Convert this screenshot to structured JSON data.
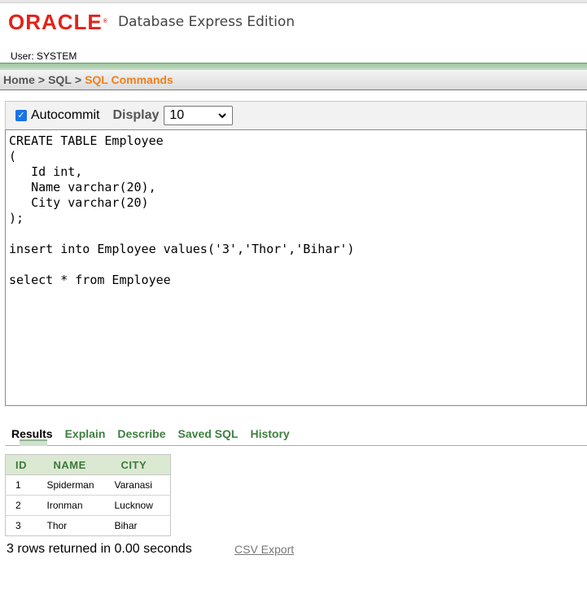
{
  "header": {
    "logo_text": "ORACLE",
    "logo_mark": "®",
    "product_name": "Database Express Edition",
    "user_line": "User: SYSTEM"
  },
  "breadcrumb": {
    "items": [
      "Home",
      "SQL",
      "SQL Commands"
    ],
    "separator": ">"
  },
  "toolbar": {
    "autocommit_checked": true,
    "autocommit_label": "Autocommit",
    "display_label": "Display",
    "display_value": "10"
  },
  "editor": {
    "lines": [
      "CREATE TABLE Employee",
      "(",
      "   Id int,",
      "   Name varchar(20),",
      "   City varchar(20)",
      ");",
      "",
      "insert into Employee values('3','Thor','Bihar')",
      "",
      "select * from Employee"
    ]
  },
  "tabs": [
    {
      "label": "Results",
      "active": true
    },
    {
      "label": "Explain",
      "active": false
    },
    {
      "label": "Describe",
      "active": false
    },
    {
      "label": "Saved SQL",
      "active": false
    },
    {
      "label": "History",
      "active": false
    }
  ],
  "results": {
    "columns": [
      "ID",
      "NAME",
      "CITY"
    ],
    "rows": [
      [
        "1",
        "Spiderman",
        "Varanasi"
      ],
      [
        "2",
        "Ironman",
        "Lucknow"
      ],
      [
        "3",
        "Thor",
        "Bihar"
      ]
    ],
    "status": "3 rows returned in 0.00 seconds",
    "export_label": "CSV Export"
  },
  "colors": {
    "brand_red": "#e2231a",
    "breadcrumb_current": "#f07f1c",
    "tab_green": "#3f7f3f",
    "table_header_bg": "#dbe9d2"
  }
}
